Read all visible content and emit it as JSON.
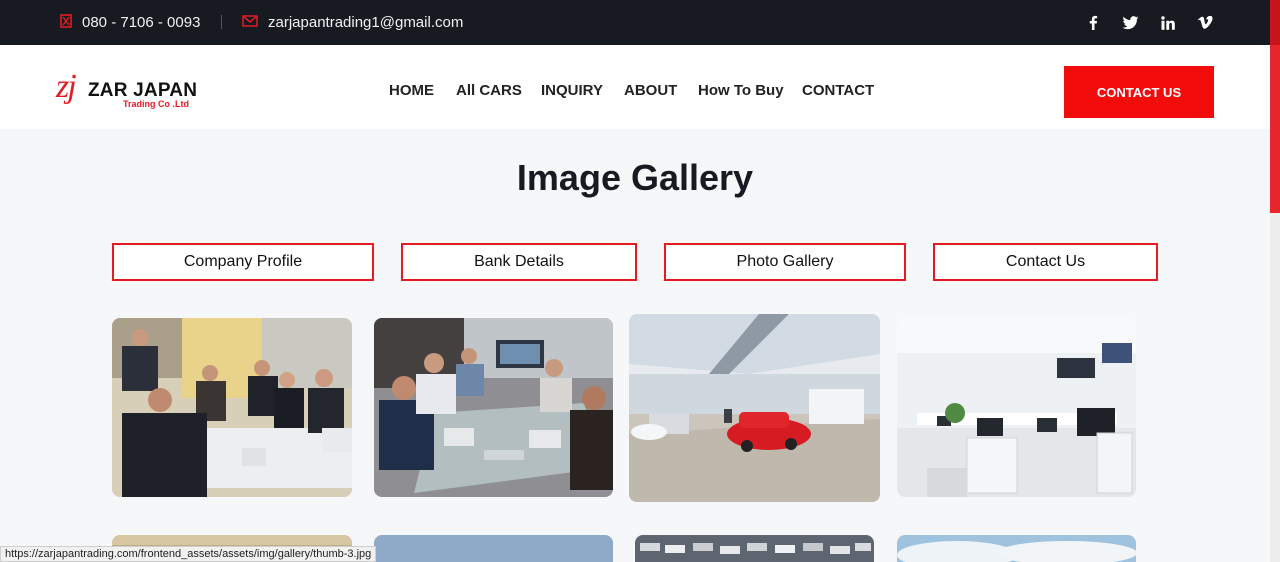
{
  "topbar": {
    "phone": "080 - 7106 - 0093",
    "email": "zarjapantrading1@gmail.com",
    "social": [
      "facebook-icon",
      "twitter-icon",
      "linkedin-icon",
      "vimeo-icon"
    ]
  },
  "header": {
    "logo_mark": "zj",
    "logo_name": "ZAR JAPAN",
    "logo_sub": "Trading Co .Ltd",
    "nav": [
      "HOME",
      "All CARS",
      "INQUIRY",
      "ABOUT",
      "How To Buy",
      "CONTACT"
    ],
    "cta": "CONTACT US"
  },
  "main": {
    "title": "Image Gallery",
    "tabs": [
      "Company Profile",
      "Bank Details",
      "Photo Gallery",
      "Contact Us"
    ],
    "gallery": [
      {
        "subject": "business-meeting-photo"
      },
      {
        "subject": "conference-table-photo"
      },
      {
        "subject": "car-showroom-photo"
      },
      {
        "subject": "open-office-photo"
      },
      {
        "subject": "gallery-photo-5"
      },
      {
        "subject": "gallery-photo-6"
      },
      {
        "subject": "car-yard-photo"
      },
      {
        "subject": "sky-photo"
      }
    ]
  },
  "status_url": "https://zarjapantrading.com/frontend_assets/assets/img/gallery/thumb-3.jpg",
  "colors": {
    "accent": "#e41b23",
    "cta_bg": "#f20c0c",
    "topbar_bg": "#171a21",
    "page_bg": "#f6f7f9"
  }
}
